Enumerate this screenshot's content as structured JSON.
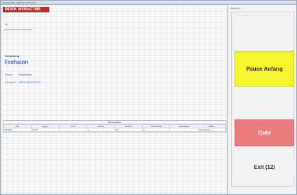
{
  "window": {
    "title": "Terminal 4411 - ${Sensor Client} Obj"
  },
  "brand": {
    "text": "BOEK MOBATIME"
  },
  "left": {
    "nav_arrow": "↳",
    "section_label": "Verwaltung",
    "employee_name": "Frohsinn",
    "status_label": "Status",
    "status_value": "Anwesend",
    "since_label": "Gung am",
    "since_value": "25.09.2013 07:03"
  },
  "table": {
    "title": "Buchungsliste",
    "columns": [
      "Zeit",
      "Region",
      "Grob",
      "Auftrag",
      "Position",
      "Kostenstelle",
      "Arbeitsgang",
      "Status"
    ],
    "rows": [
      [
        "08.2013",
        "07:03",
        "",
        "0",
        "0.0",
        "0",
        "",
        "Anwesenheit"
      ]
    ]
  },
  "right": {
    "panel_label": "Erfassung",
    "pause_label": "Pause Anfang",
    "geht_label": "Geht",
    "exit_label": "Exit (12)"
  }
}
